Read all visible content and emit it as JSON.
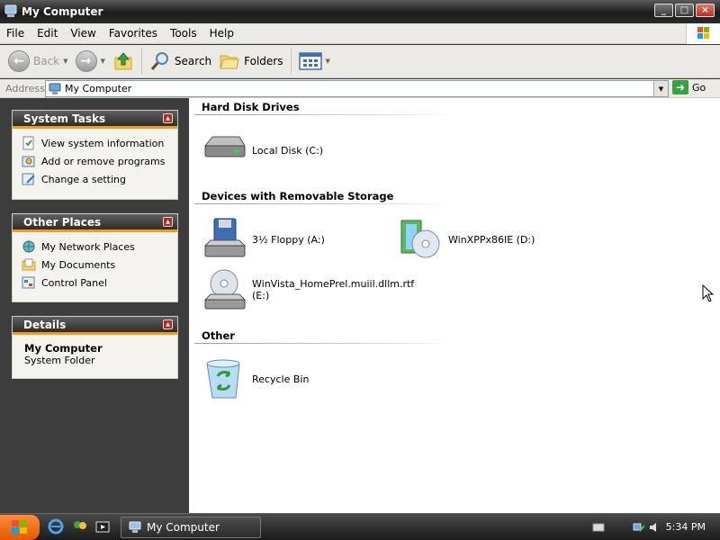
{
  "window": {
    "title": "My Computer",
    "buttons": {
      "minimize": "_",
      "maximize": "□",
      "close": "×"
    }
  },
  "menu": {
    "items": [
      "File",
      "Edit",
      "View",
      "Favorites",
      "Tools",
      "Help"
    ]
  },
  "toolbar": {
    "back_label": "Back",
    "search_label": "Search",
    "folders_label": "Folders"
  },
  "address": {
    "label": "Address",
    "value": "My Computer",
    "go_label": "Go"
  },
  "left_pane": {
    "system_tasks": {
      "title": "System Tasks",
      "items": [
        "View system information",
        "Add or remove programs",
        "Change a setting"
      ]
    },
    "other_places": {
      "title": "Other Places",
      "items": [
        "My Network Places",
        "My Documents",
        "Control Panel"
      ]
    },
    "details": {
      "title": "Details",
      "name": "My Computer",
      "type": "System Folder"
    }
  },
  "content": {
    "groups": [
      {
        "title": "Hard Disk Drives",
        "items": [
          {
            "label": "Local Disk (C:)",
            "icon": "hard-disk-icon"
          }
        ]
      },
      {
        "title": "Devices with Removable Storage",
        "items": [
          {
            "label": "3½ Floppy (A:)",
            "icon": "floppy-drive-icon"
          },
          {
            "label": "WinXPPx86IE (D:)",
            "icon": "cd-drive-icon"
          },
          {
            "label": "WinVista_HomePrel.muiil.dllm.rtf (E:)",
            "icon": "dvd-drive-icon"
          }
        ]
      },
      {
        "title": "Other",
        "items": [
          {
            "label": "Recycle Bin",
            "icon": "recycle-bin-icon"
          }
        ]
      }
    ]
  },
  "taskbar": {
    "active_task": "My Computer",
    "clock": "5:34 PM"
  },
  "colors": {
    "panel_accent": "#f29b1c",
    "start_button": "#e05b00",
    "dark_chrome": "#2a2a2a"
  }
}
